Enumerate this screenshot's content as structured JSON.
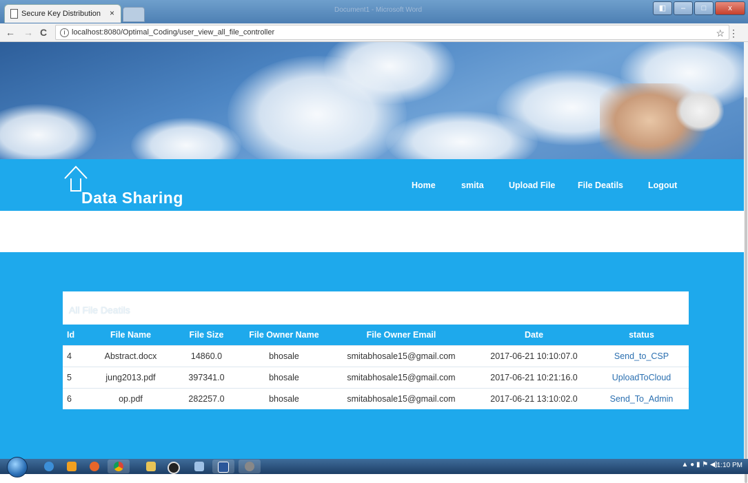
{
  "browser": {
    "tab_title": "Secure Key Distribution",
    "tab_close": "×",
    "window_title": "Document1 - Microsoft Word",
    "url": "localhost:8080/Optimal_Coding/user_view_all_file_controller",
    "back": "←",
    "forward": "→",
    "reload": "C",
    "bookmark": "☆",
    "menu": "⋮"
  },
  "site": {
    "logo_text": "Data Sharing",
    "nav": [
      "Home",
      "smita",
      "Upload File",
      "File Deatils",
      "Logout"
    ]
  },
  "panel": {
    "title": "All File Deatils",
    "columns": [
      "Id",
      "File Name",
      "File Size",
      "File Owner Name",
      "File Owner Email",
      "Date",
      "status"
    ],
    "rows": [
      [
        "4",
        "Abstract.docx",
        "14860.0",
        "bhosale",
        "smitabhosale15@gmail.com",
        "2017-06-21 10:10:07.0",
        "Send_to_CSP"
      ],
      [
        "5",
        "jung2013.pdf",
        "397341.0",
        "bhosale",
        "smitabhosale15@gmail.com",
        "2017-06-21 10:21:16.0",
        "UploadToCloud"
      ],
      [
        "6",
        "op.pdf",
        "282257.0",
        "bhosale",
        "smitabhosale15@gmail.com",
        "2017-06-21 13:10:02.0",
        "Send_To_Admin"
      ]
    ]
  },
  "taskbar": {
    "clock": "1:10 PM",
    "items": [
      "internet-explorer-icon",
      "media-player-icon",
      "firefox-icon",
      "chrome-icon",
      "explorer-folder-icon",
      "app-icon",
      "pen-tool-icon",
      "word-icon",
      "settings-icon"
    ]
  },
  "colors": {
    "accent": "#1ea9ec",
    "status_link": "#2a6fb0"
  }
}
